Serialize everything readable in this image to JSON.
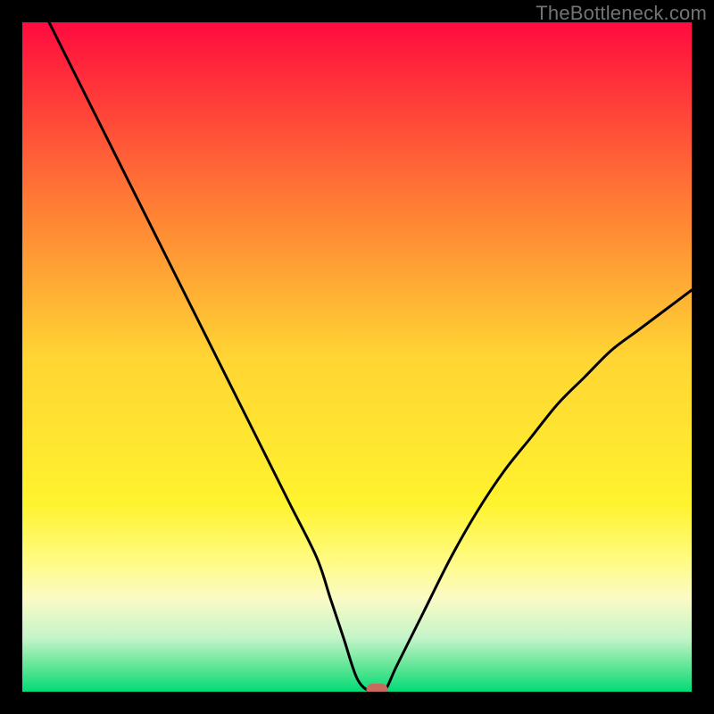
{
  "watermark": "TheBottleneck.com",
  "chart_data": {
    "type": "line",
    "title": "",
    "xlabel": "",
    "ylabel": "",
    "xlim": [
      0,
      100
    ],
    "ylim": [
      0,
      100
    ],
    "x": [
      4,
      8,
      12,
      16,
      20,
      24,
      28,
      32,
      36,
      40,
      44,
      46,
      48,
      50,
      52,
      54,
      56,
      60,
      64,
      68,
      72,
      76,
      80,
      84,
      88,
      92,
      96,
      100
    ],
    "values": [
      100,
      92,
      84,
      76,
      68,
      60,
      52,
      44,
      36,
      28,
      20,
      14,
      8,
      2,
      0,
      0,
      4,
      12,
      20,
      27,
      33,
      38,
      43,
      47,
      51,
      54,
      57,
      60
    ],
    "marker": {
      "x": 53,
      "y": 0
    },
    "gradient_stops": [
      {
        "offset": 0.0,
        "color": "#ff0b3e"
      },
      {
        "offset": 0.25,
        "color": "#ff7435"
      },
      {
        "offset": 0.5,
        "color": "#ffd533"
      },
      {
        "offset": 0.72,
        "color": "#fff32e"
      },
      {
        "offset": 0.8,
        "color": "#fffb7e"
      },
      {
        "offset": 0.86,
        "color": "#fbfbc5"
      },
      {
        "offset": 0.92,
        "color": "#c4f4c9"
      },
      {
        "offset": 0.97,
        "color": "#4fe38e"
      },
      {
        "offset": 1.0,
        "color": "#00db77"
      }
    ]
  }
}
